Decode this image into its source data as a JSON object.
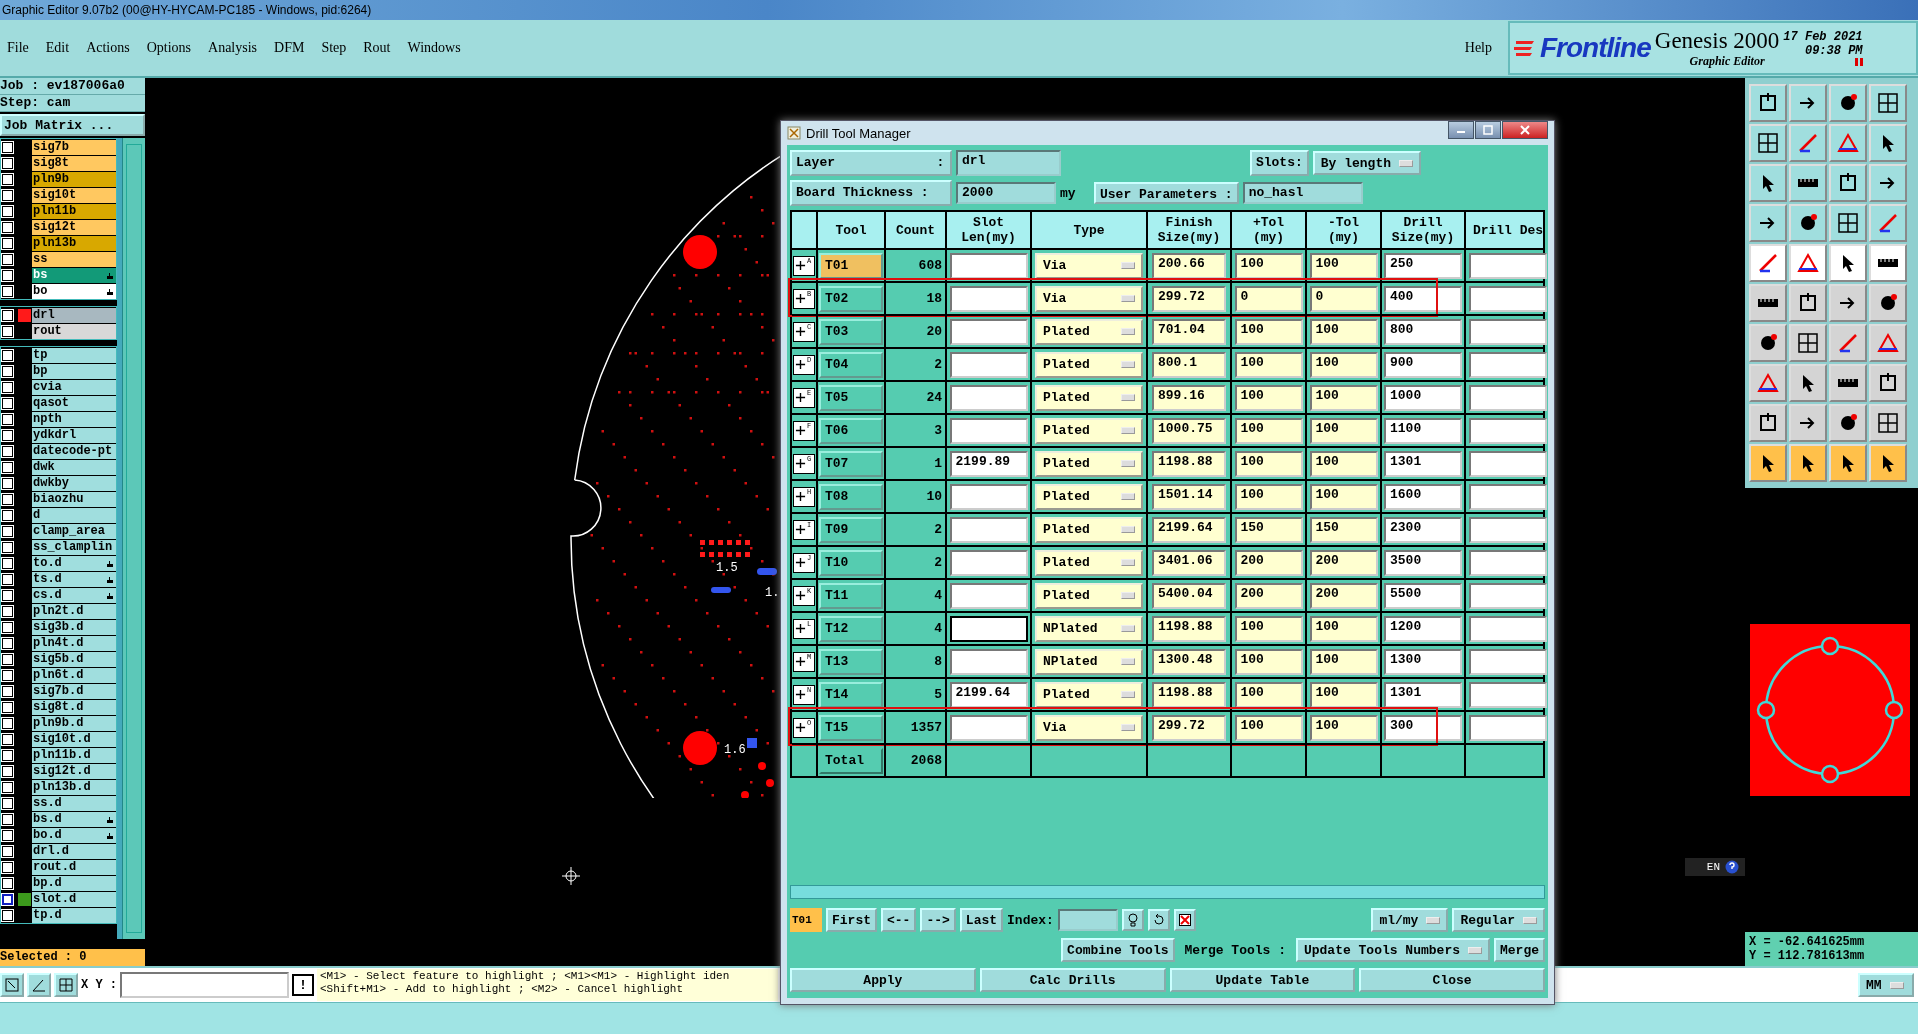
{
  "window": {
    "title": "Graphic Editor 9.07b2 (00@HY-HYCAM-PC185 - Windows, pid:6264)"
  },
  "menu": [
    "File",
    "Edit",
    "Actions",
    "Options",
    "Analysis",
    "DFM",
    "Step",
    "Rout",
    "Windows"
  ],
  "help": "Help",
  "brand": {
    "logo": "Frontline",
    "product": "Genesis 2000",
    "subtitle": "Graphic Editor",
    "date": "17 Feb 2021",
    "time": "09:38 PM"
  },
  "job": {
    "job": "Job : ev187006a0",
    "step": "Step: cam",
    "matrix_button": "Job Matrix ..."
  },
  "layer_groups": [
    {
      "layers": [
        {
          "name": "sig7b",
          "kind": "signal",
          "checked": false,
          "hand": false
        },
        {
          "name": "sig8t",
          "kind": "signal",
          "checked": false,
          "hand": false
        },
        {
          "name": "pln9b",
          "kind": "plane",
          "checked": false,
          "hand": false
        },
        {
          "name": "sig10t",
          "kind": "signal",
          "checked": false,
          "hand": false
        },
        {
          "name": "pln11b",
          "kind": "plane",
          "checked": false,
          "hand": false
        },
        {
          "name": "sig12t",
          "kind": "signal",
          "checked": false,
          "hand": false
        },
        {
          "name": "pln13b",
          "kind": "plane",
          "checked": false,
          "hand": false
        },
        {
          "name": "ss",
          "kind": "signal",
          "checked": false,
          "hand": false
        },
        {
          "name": "bs",
          "kind": "mask",
          "checked": false,
          "hand": true
        },
        {
          "name": "bo",
          "kind": "silk",
          "checked": false,
          "hand": true
        }
      ]
    },
    {
      "layers": [
        {
          "name": "drl",
          "kind": "drill",
          "checked": false,
          "hand": false,
          "color": "#ff1a1a"
        },
        {
          "name": "rout",
          "kind": "rout",
          "checked": false,
          "hand": false
        }
      ]
    },
    {
      "layers": [
        {
          "name": "tp",
          "kind": "misc",
          "checked": false,
          "hand": false
        },
        {
          "name": "bp",
          "kind": "misc",
          "checked": false,
          "hand": false
        },
        {
          "name": "cvia",
          "kind": "misc",
          "checked": false,
          "hand": false
        },
        {
          "name": "qasot",
          "kind": "misc",
          "checked": false,
          "hand": false
        },
        {
          "name": "npth",
          "kind": "misc",
          "checked": false,
          "hand": false
        },
        {
          "name": "ydkdrl",
          "kind": "misc",
          "checked": false,
          "hand": false
        },
        {
          "name": "datecode-pt",
          "kind": "misc",
          "checked": false,
          "hand": false
        },
        {
          "name": "dwk",
          "kind": "misc",
          "checked": false,
          "hand": false
        },
        {
          "name": "dwkby",
          "kind": "misc",
          "checked": false,
          "hand": false
        },
        {
          "name": "biaozhu",
          "kind": "misc",
          "checked": false,
          "hand": false
        },
        {
          "name": "d",
          "kind": "misc",
          "checked": false,
          "hand": false
        },
        {
          "name": "clamp_area",
          "kind": "misc",
          "checked": false,
          "hand": false
        },
        {
          "name": "ss_clamplin",
          "kind": "misc",
          "checked": false,
          "hand": false
        },
        {
          "name": "to.d",
          "kind": "misc",
          "checked": false,
          "hand": true
        },
        {
          "name": "ts.d",
          "kind": "misc",
          "checked": false,
          "hand": true
        },
        {
          "name": "cs.d",
          "kind": "misc",
          "checked": false,
          "hand": true
        },
        {
          "name": "pln2t.d",
          "kind": "misc",
          "checked": false,
          "hand": false
        },
        {
          "name": "sig3b.d",
          "kind": "misc",
          "checked": false,
          "hand": false
        },
        {
          "name": "pln4t.d",
          "kind": "misc",
          "checked": false,
          "hand": false
        },
        {
          "name": "sig5b.d",
          "kind": "misc",
          "checked": false,
          "hand": false
        },
        {
          "name": "pln6t.d",
          "kind": "misc",
          "checked": false,
          "hand": false
        },
        {
          "name": "sig7b.d",
          "kind": "misc",
          "checked": false,
          "hand": false
        },
        {
          "name": "sig8t.d",
          "kind": "misc",
          "checked": false,
          "hand": false
        },
        {
          "name": "pln9b.d",
          "kind": "misc",
          "checked": false,
          "hand": false
        },
        {
          "name": "sig10t.d",
          "kind": "misc",
          "checked": false,
          "hand": false
        },
        {
          "name": "pln11b.d",
          "kind": "misc",
          "checked": false,
          "hand": false
        },
        {
          "name": "sig12t.d",
          "kind": "misc",
          "checked": false,
          "hand": false
        },
        {
          "name": "pln13b.d",
          "kind": "misc",
          "checked": false,
          "hand": false
        },
        {
          "name": "ss.d",
          "kind": "misc",
          "checked": false,
          "hand": false
        },
        {
          "name": "bs.d",
          "kind": "misc",
          "checked": false,
          "hand": true
        },
        {
          "name": "bo.d",
          "kind": "misc",
          "checked": false,
          "hand": true
        },
        {
          "name": "drl.d",
          "kind": "misc",
          "checked": false,
          "hand": false
        },
        {
          "name": "rout.d",
          "kind": "misc",
          "checked": false,
          "hand": false
        },
        {
          "name": "bp.d",
          "kind": "misc",
          "checked": false,
          "hand": false
        },
        {
          "name": "slot.d",
          "kind": "misc",
          "checked": false,
          "hand": false,
          "color": "#3c9a1c"
        },
        {
          "name": "tp.d",
          "kind": "misc",
          "checked": false,
          "hand": false
        }
      ]
    }
  ],
  "selected_count": "Selected : 0",
  "canvas_labels": [
    "1.5",
    "1.",
    "1.6"
  ],
  "ime_indicator": "EN",
  "coordinates": {
    "x": "X = -62.641625mm",
    "y": "Y = 112.781613mm"
  },
  "status_bar": {
    "xy_label": "X Y :",
    "warn_button": "!",
    "hints": [
      "<M1> - Select feature to highlight ; <M1><M1> - Highlight iden",
      "<Shift+M1> - Add to highlight ; <M2> - Cancel highlight"
    ],
    "units": "MM"
  },
  "dialog": {
    "title": "Drill Tool Manager",
    "layer_label": "Layer             :",
    "layer_value": "drl",
    "slots_label": "Slots:",
    "slots_value": "By length",
    "thickness_label": "Board Thickness :",
    "thickness_value": "2000",
    "thickness_unit": "my",
    "user_params_label": "User Parameters :",
    "user_params_value": "no_hasl",
    "columns": [
      "Tool",
      "Count",
      "Slot Len(my)",
      "Type",
      "Finish Size(my)",
      "+Tol (my)",
      "-Tol (my)",
      "Drill Size(my)",
      "Drill Des"
    ],
    "rows": [
      {
        "letter": "A",
        "tool": "T01",
        "selected": true,
        "highlighted": false,
        "count": "608",
        "type": "Via",
        "finish": "200.66",
        "plus_tol": "100",
        "minus_tol": "100",
        "drill": "250"
      },
      {
        "letter": "B",
        "tool": "T02",
        "selected": false,
        "highlighted": true,
        "count": "18",
        "type": "Via",
        "finish": "299.72",
        "plus_tol": "0",
        "minus_tol": "0",
        "drill": "400"
      },
      {
        "letter": "C",
        "tool": "T03",
        "selected": false,
        "highlighted": false,
        "count": "20",
        "type": "Plated",
        "finish": "701.04",
        "plus_tol": "100",
        "minus_tol": "100",
        "drill": "800"
      },
      {
        "letter": "D",
        "tool": "T04",
        "selected": false,
        "highlighted": false,
        "count": "2",
        "type": "Plated",
        "finish": "800.1",
        "plus_tol": "100",
        "minus_tol": "100",
        "drill": "900"
      },
      {
        "letter": "E",
        "tool": "T05",
        "selected": false,
        "highlighted": false,
        "count": "24",
        "type": "Plated",
        "finish": "899.16",
        "plus_tol": "100",
        "minus_tol": "100",
        "drill": "1000"
      },
      {
        "letter": "F",
        "tool": "T06",
        "selected": false,
        "highlighted": false,
        "count": "3",
        "type": "Plated",
        "finish": "1000.75",
        "plus_tol": "100",
        "minus_tol": "100",
        "drill": "1100"
      },
      {
        "letter": "G",
        "tool": "T07",
        "selected": false,
        "highlighted": false,
        "count": "1",
        "slot_len": "2199.89",
        "type": "Plated",
        "finish": "1198.88",
        "plus_tol": "100",
        "minus_tol": "100",
        "drill": "1301"
      },
      {
        "letter": "H",
        "tool": "T08",
        "selected": false,
        "highlighted": false,
        "count": "10",
        "type": "Plated",
        "finish": "1501.14",
        "plus_tol": "100",
        "minus_tol": "100",
        "drill": "1600"
      },
      {
        "letter": "I",
        "tool": "T09",
        "selected": false,
        "highlighted": false,
        "count": "2",
        "type": "Plated",
        "finish": "2199.64",
        "plus_tol": "150",
        "minus_tol": "150",
        "drill": "2300"
      },
      {
        "letter": "J",
        "tool": "T10",
        "selected": false,
        "highlighted": false,
        "count": "2",
        "type": "Plated",
        "finish": "3401.06",
        "plus_tol": "200",
        "minus_tol": "200",
        "drill": "3500"
      },
      {
        "letter": "K",
        "tool": "T11",
        "selected": false,
        "highlighted": false,
        "count": "4",
        "type": "Plated",
        "finish": "5400.04",
        "plus_tol": "200",
        "minus_tol": "200",
        "drill": "5500"
      },
      {
        "letter": "L",
        "tool": "T12",
        "selected": false,
        "highlighted": false,
        "count": "4",
        "type": "NPlated",
        "finish": "1198.88",
        "plus_tol": "100",
        "minus_tol": "100",
        "drill": "1200"
      },
      {
        "letter": "M",
        "tool": "T13",
        "selected": false,
        "highlighted": false,
        "count": "8",
        "type": "NPlated",
        "finish": "1300.48",
        "plus_tol": "100",
        "minus_tol": "100",
        "drill": "1300"
      },
      {
        "letter": "N",
        "tool": "T14",
        "selected": false,
        "highlighted": false,
        "count": "5",
        "slot_len": "2199.64",
        "type": "Plated",
        "finish": "1198.88",
        "plus_tol": "100",
        "minus_tol": "100",
        "drill": "1301"
      },
      {
        "letter": "O",
        "tool": "T15",
        "selected": false,
        "highlighted": true,
        "count": "1357",
        "type": "Via",
        "finish": "299.72",
        "plus_tol": "100",
        "minus_tol": "100",
        "drill": "300"
      }
    ],
    "total_label": "Total",
    "total_count": "2068",
    "current_tool": "T01",
    "nav": [
      "First",
      "<--",
      "-->",
      "Last"
    ],
    "index_label": "Index:",
    "units": "ml/my",
    "mode": "Regular",
    "combine": "Combine Tools",
    "merge_label": "Merge Tools :",
    "update_numbers": "Update Tools Numbers",
    "merge": "Merge",
    "actions": [
      "Apply",
      "Calc Drills",
      "Update Table",
      "Close"
    ]
  }
}
